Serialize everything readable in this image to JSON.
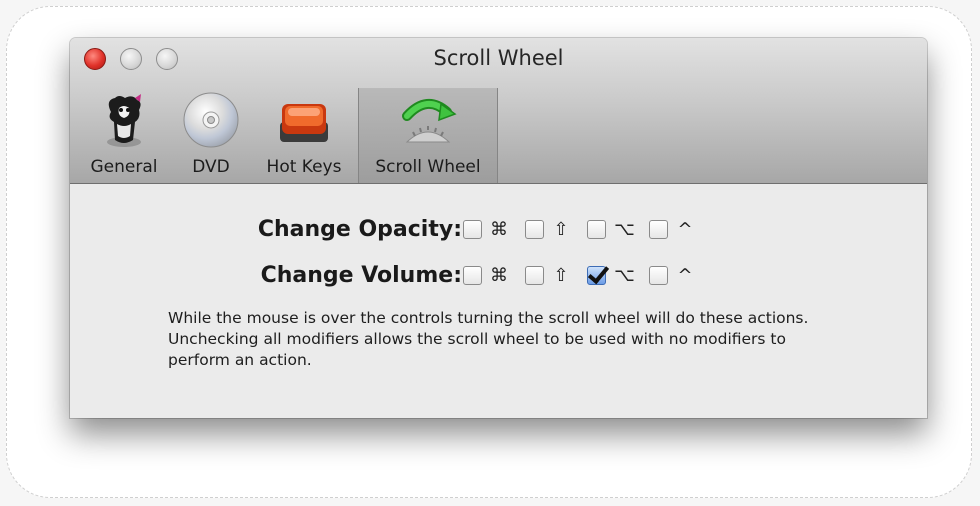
{
  "window": {
    "title": "Scroll Wheel"
  },
  "toolbar": {
    "items": [
      {
        "label": "General",
        "icon": "general-icon"
      },
      {
        "label": "DVD",
        "icon": "dvd-icon"
      },
      {
        "label": "Hot Keys",
        "icon": "hot-keys-icon"
      },
      {
        "label": "Scroll Wheel",
        "icon": "scroll-wheel-icon",
        "selected": true
      }
    ]
  },
  "settings": {
    "opacity": {
      "label": "Change Opacity:",
      "modifiers": [
        {
          "symbol": "⌘",
          "name": "command",
          "checked": false
        },
        {
          "symbol": "⇧",
          "name": "shift",
          "checked": false
        },
        {
          "symbol": "⌥",
          "name": "option",
          "checked": false
        },
        {
          "symbol": "^",
          "name": "control",
          "checked": false
        }
      ]
    },
    "volume": {
      "label": "Change Volume:",
      "modifiers": [
        {
          "symbol": "⌘",
          "name": "command",
          "checked": false
        },
        {
          "symbol": "⇧",
          "name": "shift",
          "checked": false
        },
        {
          "symbol": "⌥",
          "name": "option",
          "checked": true
        },
        {
          "symbol": "^",
          "name": "control",
          "checked": false
        }
      ]
    },
    "description": "While the mouse is over the controls turning the scroll wheel will do these actions.  Unchecking all modifiers allows the scroll wheel to be used with no modifiers to perform an action."
  }
}
